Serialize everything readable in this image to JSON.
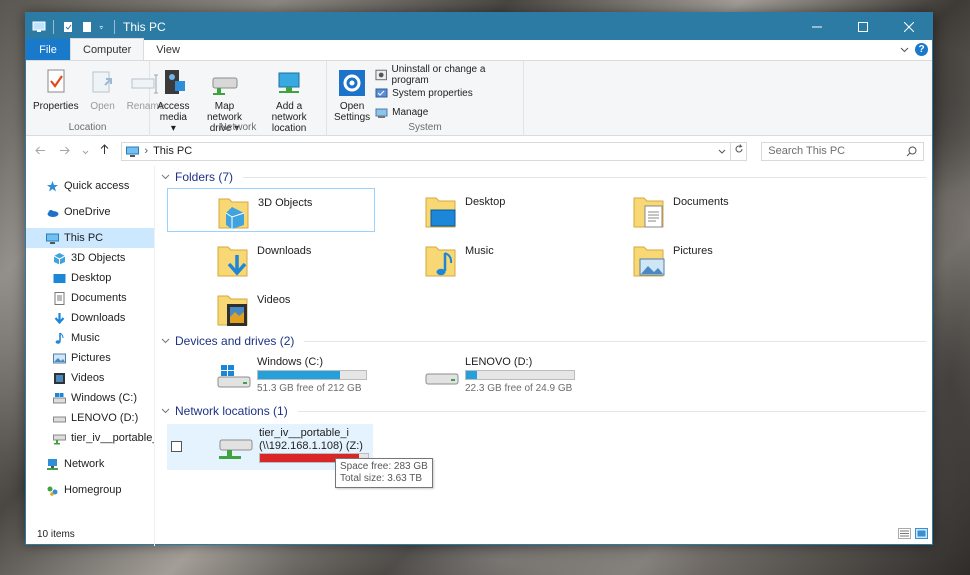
{
  "window": {
    "title": "This PC"
  },
  "ribbon_tabs": [
    {
      "label": "File"
    },
    {
      "label": "Computer"
    },
    {
      "label": "View"
    }
  ],
  "help_label": "?",
  "groups": {
    "location": {
      "label": "Location",
      "buttons": [
        {
          "label": "Properties"
        },
        {
          "label": "Open"
        },
        {
          "label": "Rename"
        }
      ]
    },
    "network": {
      "label": "Network",
      "buttons": [
        {
          "label": "Access",
          "label2": "media ▾"
        },
        {
          "label": "Map network",
          "label2": "drive ▾"
        },
        {
          "label": "Add a network",
          "label2": "location"
        }
      ]
    },
    "system": {
      "label": "System",
      "big": {
        "label": "Open",
        "label2": "Settings"
      },
      "small": [
        {
          "label": "Uninstall or change a program"
        },
        {
          "label": "System properties"
        },
        {
          "label": "Manage"
        }
      ]
    }
  },
  "address": {
    "path": "This PC",
    "separator": "›"
  },
  "search": {
    "placeholder": "Search This PC"
  },
  "sidebar": [
    {
      "label": "Quick access"
    },
    {
      "label": "OneDrive"
    },
    {
      "label": "This PC"
    },
    {
      "label": "3D Objects"
    },
    {
      "label": "Desktop"
    },
    {
      "label": "Documents"
    },
    {
      "label": "Downloads"
    },
    {
      "label": "Music"
    },
    {
      "label": "Pictures"
    },
    {
      "label": "Videos"
    },
    {
      "label": "Windows (C:)"
    },
    {
      "label": "LENOVO (D:)"
    },
    {
      "label": "tier_iv__portable_i ("
    },
    {
      "label": "Network"
    },
    {
      "label": "Homegroup"
    }
  ],
  "sections": {
    "folders": {
      "title": "Folders (7)"
    },
    "devices": {
      "title": "Devices and drives (2)"
    },
    "network": {
      "title": "Network locations (1)"
    }
  },
  "folders": [
    {
      "name": "3D Objects"
    },
    {
      "name": "Desktop"
    },
    {
      "name": "Documents"
    },
    {
      "name": "Downloads"
    },
    {
      "name": "Music"
    },
    {
      "name": "Pictures"
    },
    {
      "name": "Videos"
    }
  ],
  "drives": [
    {
      "name": "Windows (C:)",
      "free": "51.3 GB free of 212 GB",
      "used_fraction": 0.76
    },
    {
      "name": "LENOVO (D:)",
      "free": "22.3 GB free of 24.9 GB",
      "used_fraction": 0.1
    }
  ],
  "network_location": {
    "name1": "tier_iv__portable_i",
    "name2": "(\\\\192.168.1.108) (Z:)",
    "used_fraction": 0.92
  },
  "tooltip": {
    "line1": "Space free: 283 GB",
    "line2": "Total size: 3.63 TB"
  },
  "status": {
    "items": "10 items"
  }
}
